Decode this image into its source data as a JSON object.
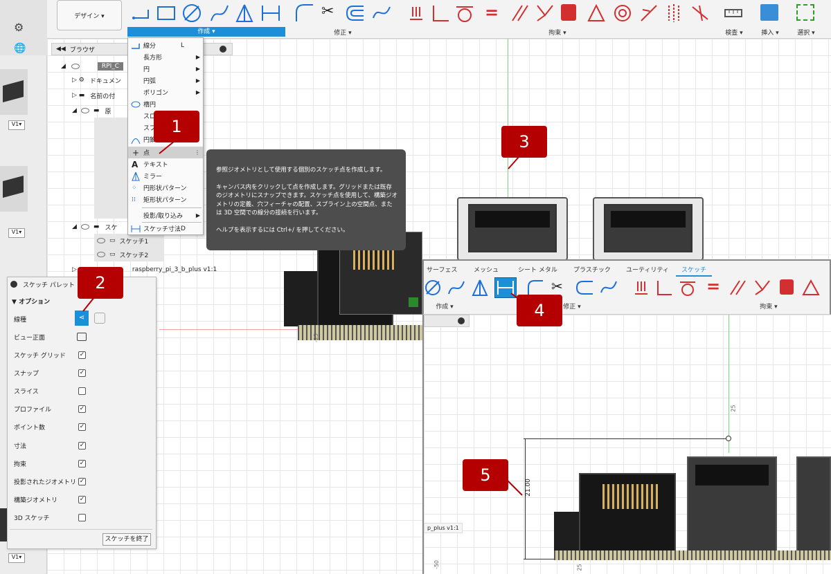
{
  "ribbon": {
    "workspace_label": "デザイン ▾",
    "group_create": "作成 ▾",
    "group_modify": "修正 ▾",
    "group_constraints": "拘束 ▾",
    "group_inspect": "検査 ▾",
    "group_insert": "挿入 ▾",
    "group_select": "選択 ▾"
  },
  "browser": {
    "title": "ブラウザ",
    "root": "RPI_C",
    "documents": "ドキュメン",
    "named_views": "名前の付",
    "origin": "原",
    "sketches": "スケ",
    "sketch1": "スケッチ1",
    "sketch2": "スケッチ2",
    "component": "raspberry_pi_3_b_plus v1:1"
  },
  "create_menu": {
    "items": [
      {
        "label": "線分",
        "shortcut": "L"
      },
      {
        "label": "長方形",
        "arrow": "▶"
      },
      {
        "label": "円",
        "arrow": "▶"
      },
      {
        "label": "円弧",
        "arrow": "▶"
      },
      {
        "label": "ポリゴン",
        "arrow": "▶"
      },
      {
        "label": "楕円"
      },
      {
        "label": "スロ"
      },
      {
        "label": "スプ"
      },
      {
        "label": "円錐"
      },
      {
        "label": "点"
      },
      {
        "label": "テキスト"
      },
      {
        "label": "ミラー"
      },
      {
        "label": "円形状パターン"
      },
      {
        "label": "矩形状パターン"
      },
      {
        "label": "投影/取り込み",
        "arrow": "▶"
      },
      {
        "label": "スケッチ寸法",
        "shortcut": "D"
      }
    ]
  },
  "tooltip": {
    "line1": "参照ジオメトリとして使用する個別のスケッチ点を作成します。",
    "line2": "キャンバス内をクリックして点を作成します。グリッドまたは既存",
    "line3": "のジオメトリにスナップできます。スケッチ点を使用して、構築ジオ",
    "line4": "メトリの定義、穴フィーチャの配置、スプライン上の空間点、また",
    "line5": "は 3D 空間での線分の接続を行います。",
    "line6": "ヘルプを表示するには Ctrl+/ を押してください。"
  },
  "palette": {
    "title": "スケッチ パレット",
    "section": "オプション",
    "rows": [
      {
        "label": "線種",
        "checked": ""
      },
      {
        "label": "ビュー正面",
        "checked": ""
      },
      {
        "label": "スケッチ グリッド",
        "checked": "✓"
      },
      {
        "label": "スナップ",
        "checked": "✓"
      },
      {
        "label": "スライス",
        "checked": ""
      },
      {
        "label": "プロファイル",
        "checked": "✓"
      },
      {
        "label": "ポイント数",
        "checked": "✓"
      },
      {
        "label": "寸法",
        "checked": "✓"
      },
      {
        "label": "拘束",
        "checked": "✓"
      },
      {
        "label": "投影されたジオメトリ",
        "checked": "✓"
      },
      {
        "label": "構築ジオメトリ",
        "checked": "✓"
      },
      {
        "label": "3D スケッチ",
        "checked": ""
      }
    ],
    "finish_button": "スケッチを終了"
  },
  "inset": {
    "tabs": [
      "サーフェス",
      "メッシュ",
      "シート メタル",
      "プラスチック",
      "ユーティリティ",
      "スケッチ"
    ],
    "group_create": "作成 ▾",
    "group_modify": "修正 ▾",
    "group_constraints": "拘束 ▾",
    "dimension_value": "21.00",
    "axis_value": "25",
    "axis_value_neg": "-50",
    "axis_value_2": "25",
    "component_fragment": "p_plus v1:1"
  },
  "left_panel": {
    "version1": "V1▾",
    "version2": "V1▾",
    "version3": "V1▾"
  },
  "main_canvas": {
    "axis_label": "-25"
  },
  "callouts": [
    "1",
    "2",
    "3",
    "4",
    "5"
  ],
  "colors": {
    "accent_blue": "#1c8fd8",
    "callout_red": "#b40000",
    "constraint_red": "#d23030"
  }
}
